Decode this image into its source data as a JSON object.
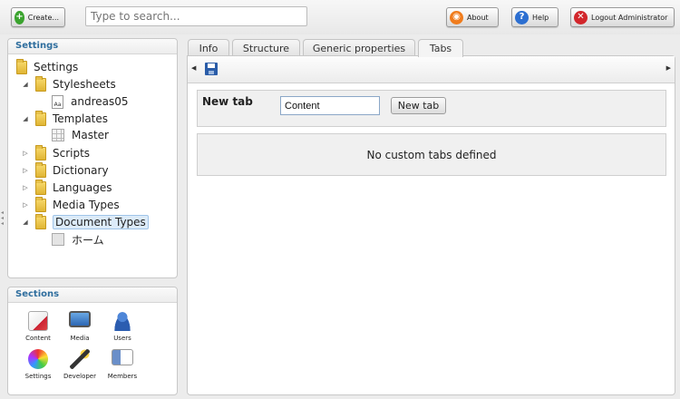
{
  "toolbar": {
    "create_label": "Create...",
    "search_placeholder": "Type to search...",
    "about_label": "About",
    "help_label": "Help",
    "logout_label": "Logout Administrator"
  },
  "settings_panel": {
    "title": "Settings",
    "tree": [
      {
        "label": "Settings",
        "icon": "folder-icon",
        "level": 0
      },
      {
        "label": "Stylesheets",
        "icon": "folder-icon",
        "level": 1,
        "expanded": true
      },
      {
        "label": "andreas05",
        "icon": "stylesheet-icon",
        "level": 2
      },
      {
        "label": "Templates",
        "icon": "folder-icon",
        "level": 1,
        "expanded": true
      },
      {
        "label": "Master",
        "icon": "template-icon",
        "level": 2
      },
      {
        "label": "Scripts",
        "icon": "folder-icon",
        "level": 1,
        "expanded": false
      },
      {
        "label": "Dictionary",
        "icon": "folder-icon",
        "level": 1,
        "expanded": false
      },
      {
        "label": "Languages",
        "icon": "folder-icon",
        "level": 1,
        "expanded": false
      },
      {
        "label": "Media Types",
        "icon": "folder-icon",
        "level": 1,
        "expanded": false
      },
      {
        "label": "Document Types",
        "icon": "folder-icon",
        "level": 1,
        "expanded": true,
        "selected": true
      },
      {
        "label": "ホーム",
        "icon": "doctype-icon",
        "level": 2
      }
    ]
  },
  "sections_panel": {
    "title": "Sections",
    "items": [
      {
        "label": "Content",
        "icon": "content-icon"
      },
      {
        "label": "Media",
        "icon": "media-icon"
      },
      {
        "label": "Users",
        "icon": "users-icon"
      },
      {
        "label": "Settings",
        "icon": "settings-icon"
      },
      {
        "label": "Developer",
        "icon": "developer-icon"
      },
      {
        "label": "Members",
        "icon": "members-icon"
      }
    ]
  },
  "main": {
    "tabs": [
      {
        "label": "Info",
        "active": false
      },
      {
        "label": "Structure",
        "active": false
      },
      {
        "label": "Generic properties",
        "active": false
      },
      {
        "label": "Tabs",
        "active": true
      }
    ],
    "new_tab_label": "New tab",
    "new_tab_value": "Content",
    "new_tab_button": "New tab",
    "empty_message": "No custom tabs defined"
  },
  "colors": {
    "accent": "#2f6e9e",
    "selection": "#dcebf9"
  }
}
